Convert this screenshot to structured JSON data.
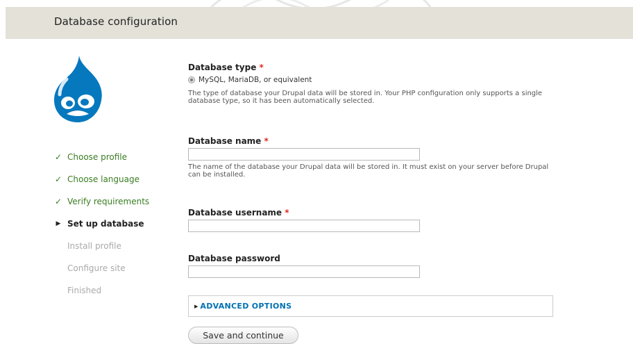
{
  "header": {
    "title": "Database configuration"
  },
  "logo": {
    "icon": "drupal-logo-icon",
    "color": "#0678be"
  },
  "steps": [
    {
      "label": "Choose profile",
      "state": "done",
      "icon": "checkmark-icon"
    },
    {
      "label": "Choose language",
      "state": "done",
      "icon": "checkmark-icon"
    },
    {
      "label": "Verify requirements",
      "state": "done",
      "icon": "checkmark-icon"
    },
    {
      "label": "Set up database",
      "state": "active",
      "icon": "triangle-right-icon"
    },
    {
      "label": "Install profile",
      "state": "todo"
    },
    {
      "label": "Configure site",
      "state": "todo"
    },
    {
      "label": "Finished",
      "state": "todo"
    }
  ],
  "form": {
    "db_type": {
      "label": "Database type",
      "required_mark": "*",
      "option": "MySQL, MariaDB, or equivalent",
      "option_selected": true,
      "description": "The type of database your Drupal data will be stored in. Your PHP configuration only supports a single database type, so it has been automatically selected."
    },
    "db_name": {
      "label": "Database name",
      "required_mark": "*",
      "value": "",
      "description": "The name of the database your Drupal data will be stored in. It must exist on your server before Drupal can be installed."
    },
    "db_username": {
      "label": "Database username",
      "required_mark": "*",
      "value": ""
    },
    "db_password": {
      "label": "Database password",
      "value": ""
    },
    "advanced": {
      "label": "ADVANCED OPTIONS"
    },
    "submit": {
      "label": "Save and continue"
    }
  },
  "colors": {
    "header_bg": "#e3e1d8",
    "done_step": "#3a7d22",
    "required": "#e02b20",
    "link": "#0071b3"
  }
}
